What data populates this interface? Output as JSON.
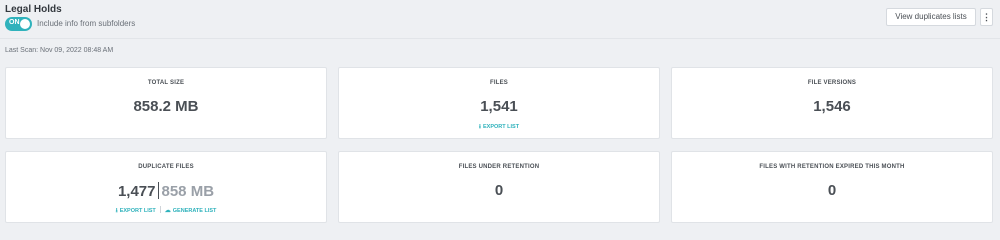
{
  "header": {
    "title": "Legal Holds",
    "toggle_state": "ON",
    "toggle_label": "Include info from subfolders",
    "view_duplicates_button": "View duplicates lists",
    "more_button": "⋮"
  },
  "last_scan": "Last Scan: Nov 09, 2022 08:48 AM",
  "cards": {
    "total_size": {
      "label": "TOTAL SIZE",
      "value": "858.2 MB"
    },
    "files": {
      "label": "FILES",
      "value": "1,541",
      "export": "EXPORT LIST"
    },
    "file_versions": {
      "label": "FILE VERSIONS",
      "value": "1,546"
    },
    "duplicate_files": {
      "label": "DUPLICATE FILES",
      "count": "1,477",
      "size": "858 MB",
      "export": "EXPORT LIST",
      "generate": "GENERATE LIST"
    },
    "files_under_retention": {
      "label": "FILES UNDER RETENTION",
      "value": "0"
    },
    "retention_expired": {
      "label": "FILES WITH RETENTION EXPIRED THIS MONTH",
      "value": "0"
    }
  },
  "colors": {
    "accent": "#2fb2bc",
    "background": "#eef0f3",
    "card": "#ffffff",
    "text": "#4a4f55"
  },
  "icons": {
    "export": "download-icon",
    "generate": "cloud-upload-icon"
  }
}
